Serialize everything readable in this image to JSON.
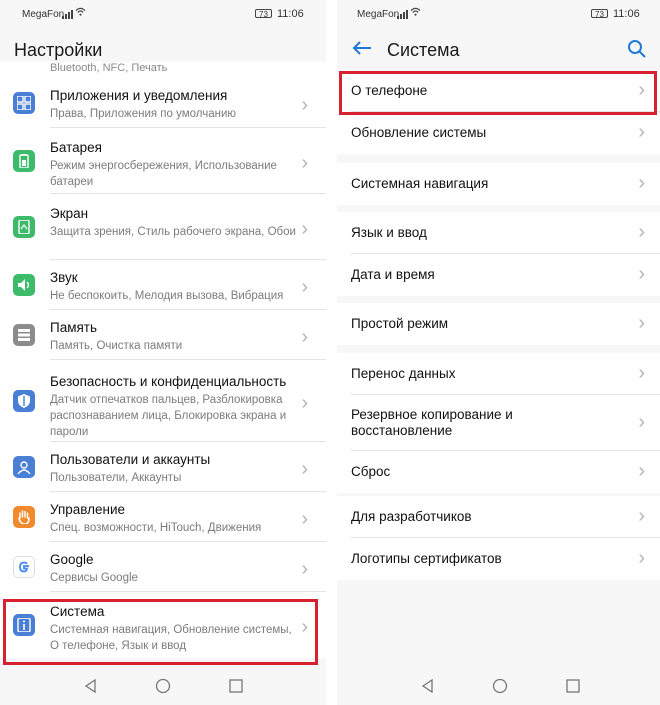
{
  "status": {
    "carrier": "MegaFon",
    "battery": "73",
    "time": "11:06"
  },
  "left": {
    "title": "Настройки",
    "cut_item_subtitle": "Bluetooth, NFC, Печать",
    "items": [
      {
        "title": "Приложения и уведомления",
        "subtitle": "Права, Приложения по умолчанию",
        "icon": "apps-icon",
        "color": "#4a7fd6"
      },
      {
        "title": "Батарея",
        "subtitle": "Режим энергосбережения, Использование батареи",
        "icon": "battery-icon",
        "color": "#3dbb6a"
      },
      {
        "title": "Экран",
        "subtitle": "Защита зрения, Стиль рабочего экрана, Обои",
        "icon": "display-icon",
        "color": "#3dbb6a"
      },
      {
        "title": "Звук",
        "subtitle": "Не беспокоить, Мелодия вызова, Вибрация",
        "icon": "sound-icon",
        "color": "#3dbb6a"
      },
      {
        "title": "Память",
        "subtitle": "Память, Очистка памяти",
        "icon": "storage-icon",
        "color": "#8c8c8c"
      },
      {
        "title": "Безопасность и конфиденциальность",
        "subtitle": "Датчик отпечатков пальцев, Разблокировка распознаванием лица, Блокировка экрана и пароли",
        "icon": "shield-icon",
        "color": "#4a7fd6"
      },
      {
        "title": "Пользователи и аккаунты",
        "subtitle": "Пользователи, Аккаунты",
        "icon": "user-icon",
        "color": "#4a7fd6"
      },
      {
        "title": "Управление",
        "subtitle": "Спец. возможности, HiTouch, Движения",
        "icon": "hand-icon",
        "color": "#f08a2c"
      },
      {
        "title": "Google",
        "subtitle": "Сервисы Google",
        "icon": "google-icon",
        "color": "#4a7fd6"
      },
      {
        "title": "Система",
        "subtitle": "Системная навигация, Обновление системы, О телефоне, Язык и ввод",
        "icon": "info-icon",
        "color": "#4a7fd6"
      }
    ]
  },
  "right": {
    "title": "Система",
    "groups": [
      [
        "О телефоне",
        "Обновление системы"
      ],
      [
        "Системная навигация"
      ],
      [
        "Язык и ввод",
        "Дата и время"
      ],
      [
        "Простой режим"
      ],
      [
        "Перенос данных",
        "Резервное копирование и восстановление",
        "Сброс"
      ],
      [
        "Для разработчиков",
        "Логотипы сертификатов"
      ]
    ]
  },
  "colors": {
    "accent": "#1e7ad8",
    "highlight": "#d62230"
  }
}
